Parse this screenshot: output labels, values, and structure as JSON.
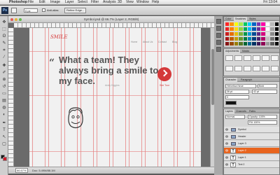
{
  "menubar": {
    "app_name": "Photoshop",
    "items": [
      "File",
      "Edit",
      "Image",
      "Layer",
      "Select",
      "Filter",
      "Analysis",
      "3D",
      "View",
      "Window",
      "Help"
    ],
    "clock": "Fri 13:04"
  },
  "optionsbar": {
    "feather_value": "0 px",
    "antialias_label": "Anti-alias",
    "refine_label": "Refine Edge..."
  },
  "document": {
    "title": "Symbol.psd @ 66.7% (Layer 2, RGB/8)",
    "zoom": "66.67%",
    "doc_info": "Doc: 5.49M/88.1M"
  },
  "mockup": {
    "logo": "SMILE",
    "nav": [
      "Home",
      "About Us",
      "Contact",
      "Blog"
    ],
    "quote_mark": "“",
    "headline": "What a team! They always bring a smile to my face.",
    "author": "Andy Higgins",
    "cta_label": "See Tour"
  },
  "panels": {
    "swatches_tabs": [
      "Color",
      "Swatches",
      "Styles"
    ],
    "adjust_tabs": [
      "Adjustments",
      "Masks"
    ],
    "character_tabs": [
      "Character",
      "Paragraph"
    ],
    "character_font": "Helvetica Neue",
    "character_style": "Bold",
    "character_size": "36 pt",
    "character_leading": "42 pt",
    "character_tracking": "0",
    "layers_tabs": [
      "Layers",
      "Channels",
      "Paths"
    ],
    "blend_mode": "Normal",
    "opacity": "Opacity: 100%",
    "fill": "Fill: 100%"
  },
  "layers": [
    {
      "name": "Symbol",
      "type": "group",
      "selected": false
    },
    {
      "name": "Header",
      "type": "group",
      "selected": false
    },
    {
      "name": "Layer 3",
      "type": "group",
      "selected": false
    },
    {
      "name": "Layer 2",
      "type": "text",
      "selected": true
    },
    {
      "name": "Layer 1",
      "type": "text",
      "selected": false
    },
    {
      "name": "Text 2",
      "type": "text",
      "selected": false
    }
  ],
  "colors": {
    "accent": "#d4393a",
    "layer_selected": "#e8641e",
    "guide": "#e67d7d"
  }
}
